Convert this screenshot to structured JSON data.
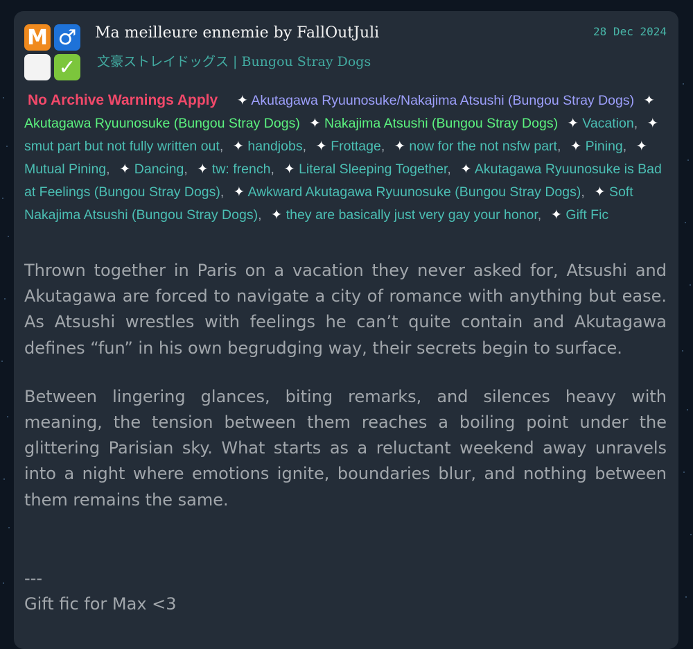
{
  "work": {
    "title_line": "Ma meilleure ennemie by FallOutJuli",
    "date": "28 Dec 2024",
    "fandom": "文豪ストレイドッグス | Bungou Stray Dogs",
    "badges": {
      "rating": "M",
      "category": "♂",
      "warning": "",
      "status": "✓"
    }
  },
  "tags": {
    "warning": "No Archive Warnings Apply",
    "relationship": "Akutagawa Ryuunosuke/Nakajima Atsushi (Bungou Stray Dogs)",
    "characters": [
      "Akutagawa Ryuunosuke (Bungou Stray Dogs)",
      "Nakajima Atsushi (Bungou Stray Dogs)"
    ],
    "freeforms": [
      "Vacation",
      "smut part but not fully written out",
      "handjobs",
      "Frottage",
      "now for the not nsfw part",
      "Pining",
      "Mutual Pining",
      "Dancing",
      "tw: french",
      "Literal Sleeping Together",
      "Akutagawa Ryuunosuke is Bad at Feelings (Bungou Stray Dogs)",
      "Awkward Akutagawa Ryuunosuke (Bungou Stray Dogs)",
      "Soft Nakajima Atsushi (Bungou Stray Dogs)",
      "they are basically just very gay your honor",
      "Gift Fic"
    ],
    "separator": ",",
    "sparkle": "✦"
  },
  "summary": {
    "paragraph_1": "Thrown together in Paris on a vacation they never asked for, Atsushi and Akutagawa are forced to navigate a city of romance with anything but ease. As Atsushi wrestles with feelings he can’t quite contain and Akutagawa defines “fun” in his own begrudging way, their secrets begin to surface.",
    "paragraph_2": "Between lingering glances, biting remarks, and silences heavy with meaning, the tension between them reaches a boiling point under the glittering Parisian sky. What starts as a reluctant weekend away unravels into a night where emotions ignite, boundaries blur, and nothing between them remains the same.",
    "divider": "---",
    "note": "Gift fic for Max <3"
  },
  "colors": {
    "card_bg": "#242d38",
    "warning": "#f2496a",
    "relationship": "#9d9ffb",
    "character": "#5cf37f",
    "freeform": "#4bbfb4",
    "date": "#48b6a8"
  }
}
